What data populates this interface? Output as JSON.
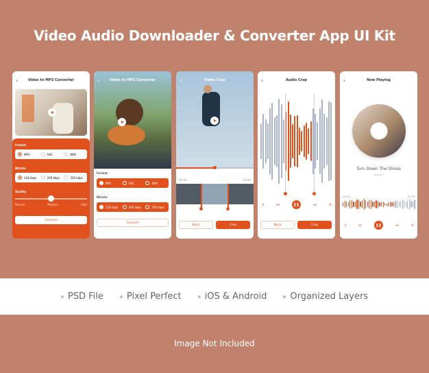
{
  "title": "Video Audio Downloader & Converter App UI Kit",
  "colors": {
    "accent": "#e0511d",
    "background": "#c0826d",
    "wave_inactive": "#a9b2c9"
  },
  "screens": {
    "s1": {
      "header": "Video to MP3 Converter",
      "format_label": "Format",
      "formats": [
        "MP3",
        "AAC",
        "WAV"
      ],
      "bitrate_label": "Bitrate",
      "bitrates": [
        "128 kbps",
        "260 kbps",
        "320 kbps"
      ],
      "quality_label": "Quality",
      "quality_ticks": [
        "Normal",
        "Medium",
        "High"
      ],
      "quality_value": 0.5,
      "convert": "Convert"
    },
    "s2": {
      "header": "Video to MP3 Converter",
      "format_label": "Format",
      "formats": [
        "MP3",
        "AAC",
        "WAV"
      ],
      "bitrate_label": "Bitrate",
      "bitrates": [
        "128 kbps",
        "260 kbps",
        "320 kbps"
      ],
      "convert": "Convert"
    },
    "s3": {
      "header": "Video Crop",
      "time_start": "00:00",
      "time_end": "16:48",
      "progress": 0.5,
      "back": "Back",
      "crop": "Crop"
    },
    "s4": {
      "header": "Audio Crop",
      "back": "Back",
      "crop": "Crop"
    },
    "s5": {
      "header": "Now Playing",
      "song": "Turn Down The Stress",
      "artist": "Anxiety",
      "time_start": "00:00",
      "time_end": "04:16"
    }
  },
  "features": [
    "PSD File",
    "Pixel Perfect",
    "iOS & Android",
    "Organized Layers"
  ],
  "footer": "Image Not Included"
}
